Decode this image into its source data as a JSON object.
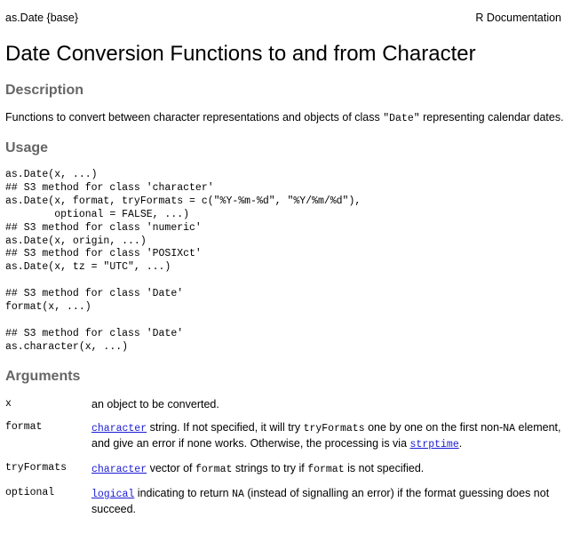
{
  "header": {
    "left": "as.Date {base}",
    "right": "R Documentation"
  },
  "title": "Date Conversion Functions to and from Character",
  "description": {
    "heading": "Description",
    "text_before": "Functions to convert between character representations and objects of class ",
    "code": "\"Date\"",
    "text_after": " representing calendar dates."
  },
  "usage": {
    "heading": "Usage",
    "code": "as.Date(x, ...)\n## S3 method for class 'character'\nas.Date(x, format, tryFormats = c(\"%Y-%m-%d\", \"%Y/%m/%d\"),\n        optional = FALSE, ...)\n## S3 method for class 'numeric'\nas.Date(x, origin, ...)\n## S3 method for class 'POSIXct'\nas.Date(x, tz = \"UTC\", ...)\n\n## S3 method for class 'Date'\nformat(x, ...)\n\n## S3 method for class 'Date'\nas.character(x, ...)"
  },
  "arguments": {
    "heading": "Arguments",
    "x": {
      "name": "x",
      "desc": "an object to be converted."
    },
    "format": {
      "name": "format",
      "link1": "character",
      "text1": " string. If not specified, it will try ",
      "code1": "tryFormats",
      "text2": " one by one on the first non-",
      "code2": "NA",
      "text3": " element, and give an error if none works. Otherwise, the processing is via ",
      "link2": "strptime",
      "text4": "."
    },
    "tryFormats": {
      "name": "tryFormats",
      "link1": "character",
      "text1": " vector of ",
      "code1": "format",
      "text2": " strings to try if ",
      "code2": "format",
      "text3": " is not specified."
    },
    "optional": {
      "name": "optional",
      "link1": "logical",
      "text1": " indicating to return ",
      "code1": "NA",
      "text2": " (instead of signalling an error) if the format guessing does not succeed."
    }
  }
}
